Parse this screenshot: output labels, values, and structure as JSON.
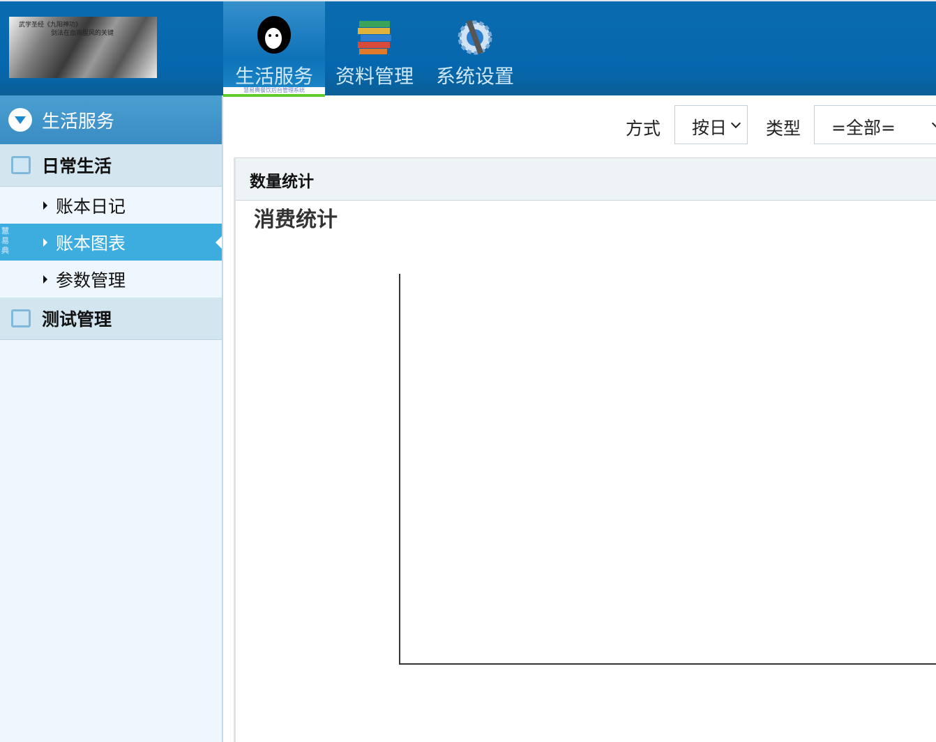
{
  "header": {
    "logo_text": [
      "武学圣经《九阳神功》",
      "剑法在血雨腥风的关键"
    ],
    "nav": [
      {
        "label": "生活服务",
        "icon": "monkey-icon",
        "active": true,
        "subtitle": "慧易典餐饮后台管理系统"
      },
      {
        "label": "资料管理",
        "icon": "books-icon"
      },
      {
        "label": "系统设置",
        "icon": "gear-wrench-icon"
      }
    ]
  },
  "sidebar": {
    "title": "生活服务",
    "vertical_tag": "慧易典",
    "groups": [
      {
        "label": "日常生活",
        "icon": "calendar-icon",
        "items": [
          {
            "label": "账本日记"
          },
          {
            "label": "账本图表",
            "selected": true
          },
          {
            "label": "参数管理"
          }
        ]
      },
      {
        "label": "测试管理",
        "icon": "edit-icon"
      }
    ]
  },
  "toolbar": {
    "mode_label": "方式",
    "mode_value": "按日",
    "type_label": "类型",
    "type_value": "=全部="
  },
  "panel": {
    "header": "数量统计",
    "chart_title": "消费统计"
  },
  "colors": {
    "header_bg": "#0667ae",
    "selected_item": "#3dade0",
    "accent_green": "#5fcc2a"
  }
}
